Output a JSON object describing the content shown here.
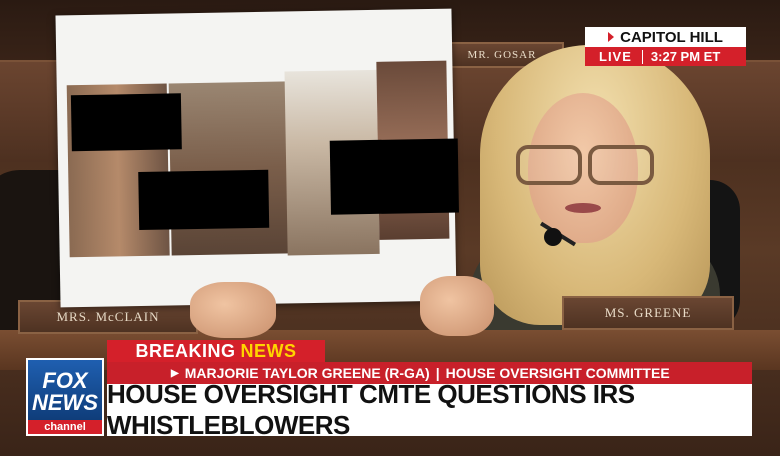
{
  "bug": {
    "network": "CAPITOL HILL",
    "live": "LIVE",
    "time": "3:27 PM ET"
  },
  "nameplates": {
    "gosar": "MR. GOSAR",
    "mcclain": "MRS. McCLAIN",
    "greene": "MS. GREENE"
  },
  "chyron": {
    "breaking": "BREAKING",
    "news": "NEWS",
    "speaker": "MARJORIE TAYLOR GREENE (R-GA)",
    "committee": "HOUSE OVERSIGHT COMMITTEE",
    "headline": "HOUSE OVERSIGHT CMTE QUESTIONS IRS WHISTLEBLOWERS"
  },
  "logo": {
    "line1": "FOX",
    "line2": "NEWS",
    "line3": "channel"
  },
  "colors": {
    "fox_red": "#d4202a",
    "fox_blue": "#1f5fb0",
    "news_yellow": "#ffd400"
  }
}
